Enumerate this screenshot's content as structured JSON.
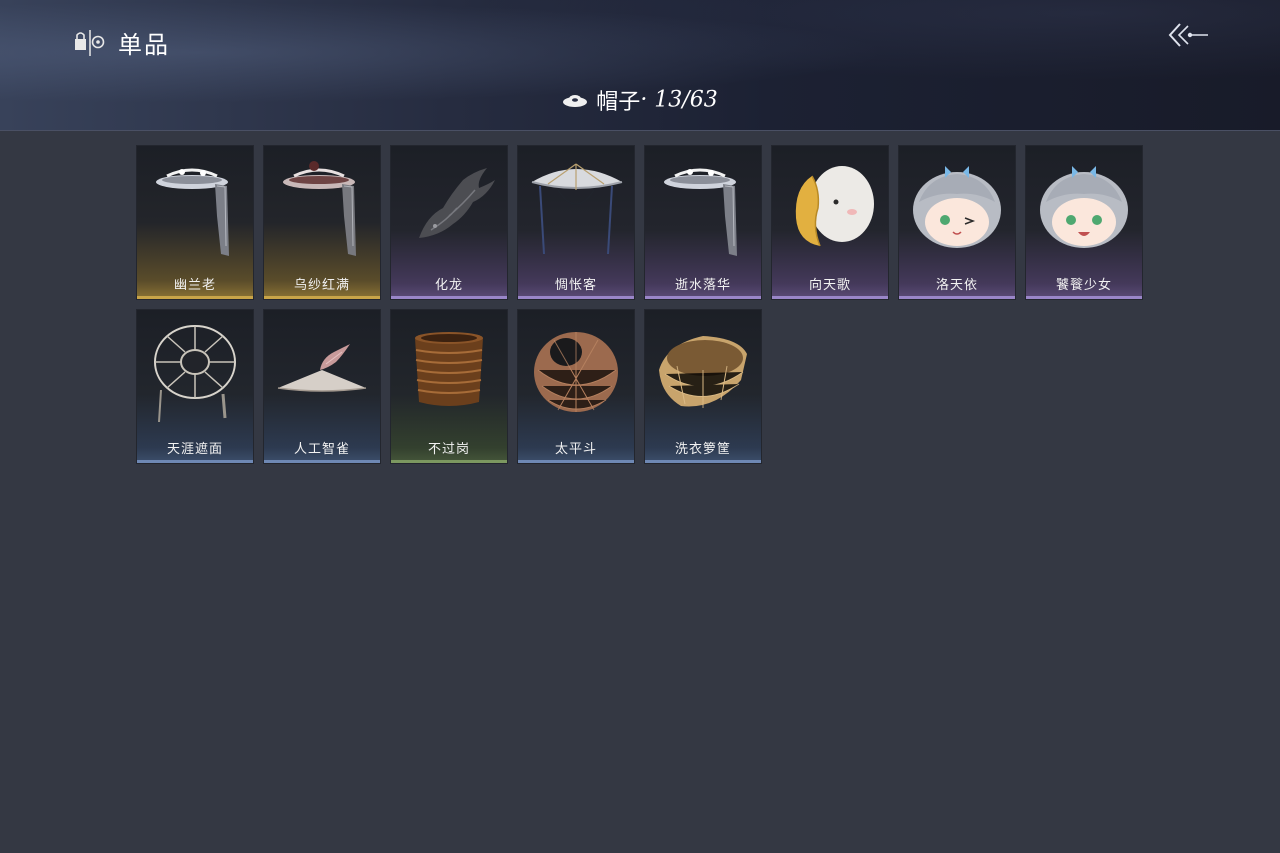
{
  "header": {
    "section_title": "单品",
    "category": {
      "label": "帽子",
      "count": "· 13/63"
    }
  },
  "items": [
    {
      "name": "幽兰老",
      "quality": "gold",
      "icon": "veiled-hat-icon"
    },
    {
      "name": "乌纱红满",
      "quality": "gold",
      "icon": "veiled-hat-red-icon"
    },
    {
      "name": "化龙",
      "quality": "purple",
      "icon": "dragon-head-icon"
    },
    {
      "name": "惆怅客",
      "quality": "purple",
      "icon": "bamboo-hat-icon"
    },
    {
      "name": "逝水落华",
      "quality": "purple",
      "icon": "veiled-hat-icon"
    },
    {
      "name": "向天歌",
      "quality": "purple",
      "icon": "goose-plush-hat-icon"
    },
    {
      "name": "洛天依",
      "quality": "purple",
      "icon": "luo-tianyi-plush-icon"
    },
    {
      "name": "饕餮少女",
      "quality": "purple",
      "icon": "luo-tianyi-smile-plush-icon"
    },
    {
      "name": "天涯遮面",
      "quality": "blue",
      "icon": "wicker-frame-hat-icon"
    },
    {
      "name": "人工智雀",
      "quality": "blue",
      "icon": "bird-hat-icon"
    },
    {
      "name": "不过岗",
      "quality": "green",
      "icon": "bowl-stack-icon"
    },
    {
      "name": "太平斗",
      "quality": "blue",
      "icon": "woven-basket-hat-icon"
    },
    {
      "name": "洗衣箩筐",
      "quality": "blue",
      "icon": "laundry-basket-icon"
    }
  ],
  "colors": {
    "background": "#343843",
    "gold": "#c8a448",
    "purple": "#9a86c8",
    "blue": "#6e88b4",
    "green": "#7c9860"
  }
}
